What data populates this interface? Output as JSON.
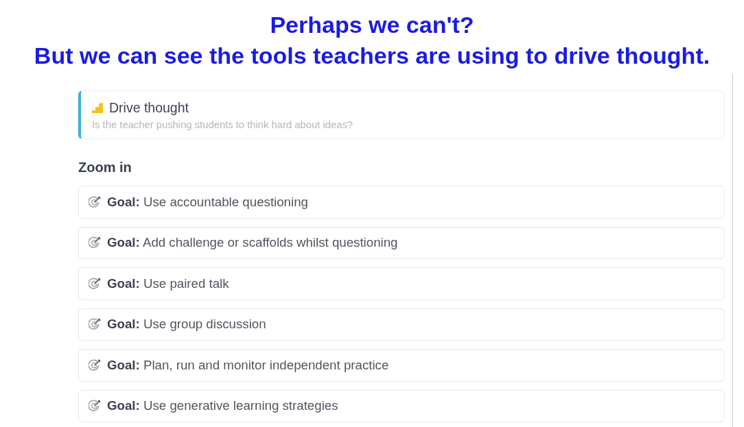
{
  "headline": {
    "lines": [
      "Perhaps we can't?",
      "But we can see the tools teachers are using to drive thought."
    ]
  },
  "focus_card": {
    "title": "Drive thought",
    "subtitle": "Is the teacher pushing students to think hard about ideas?"
  },
  "section": {
    "title": "Zoom in"
  },
  "goals": [
    {
      "text": "**Goal:** Use accountable questioning"
    },
    {
      "text": "**Goal:** Add challenge or scaffolds whilst questioning"
    },
    {
      "text": "**Goal:** Use paired talk"
    },
    {
      "text": "**Goal:** Use group discussion"
    },
    {
      "text": "**Goal:** Plan, run and monitor independent practice"
    },
    {
      "text": "**Goal:** Use generative learning strategies"
    }
  ]
}
